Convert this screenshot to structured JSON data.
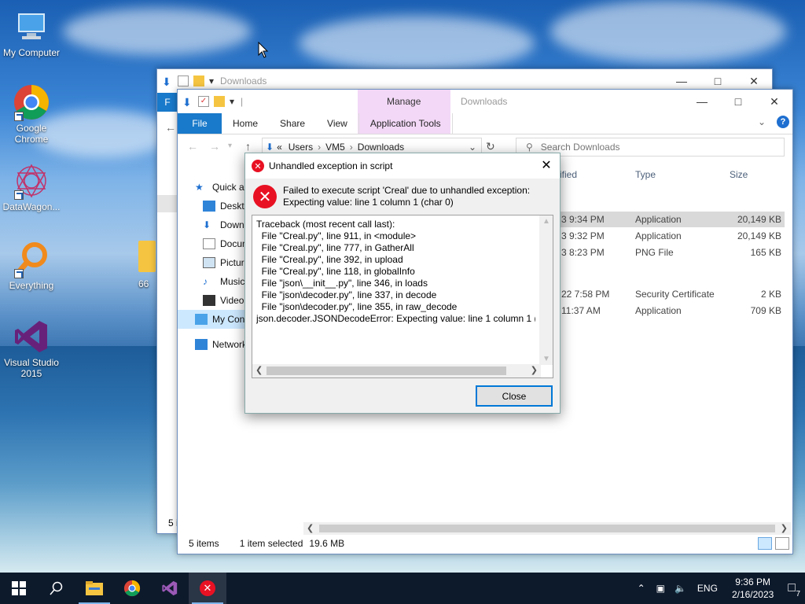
{
  "desktop": {
    "icons": [
      {
        "label": "My Computer"
      },
      {
        "label": "Google Chrome"
      },
      {
        "label": "DataWagon..."
      },
      {
        "label": "Everything"
      },
      {
        "label": "Visual Studio 2015"
      }
    ],
    "partial_folder_label": "66"
  },
  "back_window": {
    "title": "Downloads",
    "file_tab": "F",
    "status_items": "5 i"
  },
  "explorer": {
    "title": "Downloads",
    "manage_tab": "Manage",
    "tabs": [
      "File",
      "Home",
      "Share",
      "View",
      "Application Tools"
    ],
    "address": {
      "prefix": "«",
      "crumbs": [
        "Users",
        "VM5",
        "Downloads"
      ]
    },
    "search_placeholder": "Search Downloads",
    "nav": [
      {
        "label": "Quick a"
      },
      {
        "label": "Deskto"
      },
      {
        "label": "Downl"
      },
      {
        "label": "Docum"
      },
      {
        "label": "Pictur"
      },
      {
        "label": "Music"
      },
      {
        "label": "Videos"
      },
      {
        "label": "My Con"
      },
      {
        "label": "Network"
      }
    ],
    "columns": {
      "modified": "ified",
      "type": "Type",
      "size": "Size"
    },
    "files": [
      {
        "modified": "3 9:34 PM",
        "type": "Application",
        "size": "20,149 KB"
      },
      {
        "modified": "3 9:32 PM",
        "type": "Application",
        "size": "20,149 KB"
      },
      {
        "modified": "3 8:23 PM",
        "type": "PNG File",
        "size": "165 KB"
      },
      {
        "modified": "22 7:58 PM",
        "type": "Security Certificate",
        "size": "2 KB"
      },
      {
        "modified": "11:37 AM",
        "type": "Application",
        "size": "709 KB"
      }
    ],
    "status": {
      "count": "5 items",
      "selected": "1 item selected",
      "size": "19.6 MB"
    }
  },
  "dialog": {
    "title": "Unhandled exception in script",
    "message_line1": "Failed to execute script 'Creal' due to unhandled exception:",
    "message_line2": "Expecting value: line 1 column 1 (char 0)",
    "traceback": "Traceback (most recent call last):\n  File \"Creal.py\", line 911, in <module>\n  File \"Creal.py\", line 777, in GatherAll\n  File \"Creal.py\", line 392, in upload\n  File \"Creal.py\", line 118, in globalInfo\n  File \"json\\__init__.py\", line 346, in loads\n  File \"json\\decoder.py\", line 337, in decode\n  File \"json\\decoder.py\", line 355, in raw_decode\njson.decoder.JSONDecodeError: Expecting value: line 1 column 1 (cl",
    "close_label": "Close"
  },
  "taskbar": {
    "lang": "ENG",
    "time": "9:36 PM",
    "date": "2/16/2023",
    "notification_count": "7"
  }
}
